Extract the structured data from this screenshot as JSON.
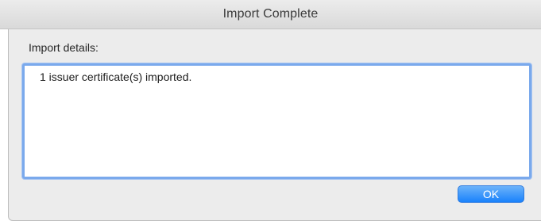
{
  "window": {
    "title": "Import Complete"
  },
  "dialog": {
    "details_label": "Import details:",
    "details_text": "1 issuer certificate(s) imported.",
    "ok_label": "OK"
  },
  "colors": {
    "accent": "#1a82fb",
    "focus_ring": "#7aa9ec"
  }
}
